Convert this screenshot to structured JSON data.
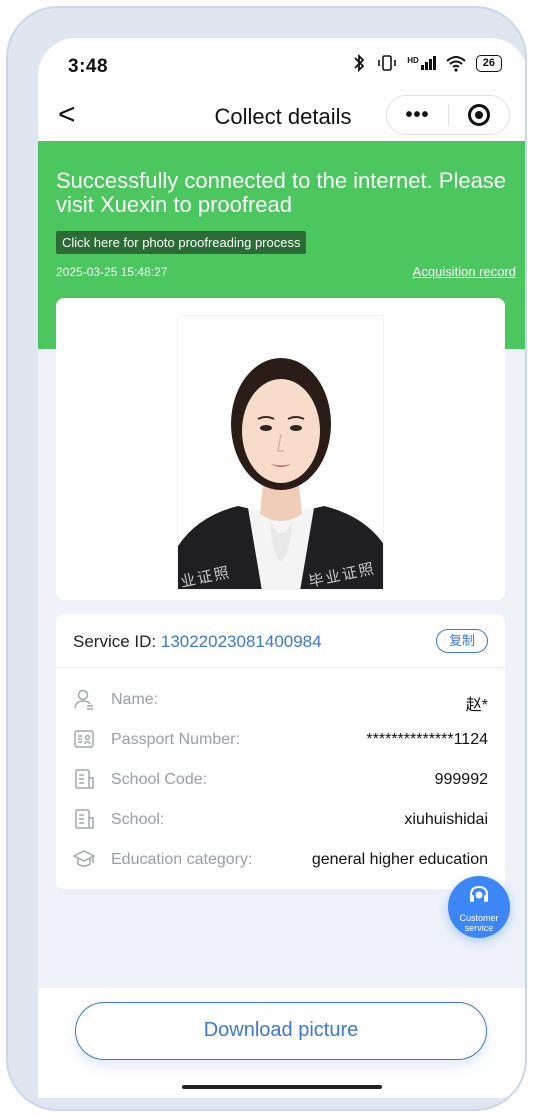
{
  "status_bar": {
    "time": "3:48",
    "icons": [
      "bluetooth-icon",
      "vibrate-icon",
      "hd-signal-icon",
      "wifi-icon"
    ],
    "signal_text": "HD",
    "battery": "26"
  },
  "nav": {
    "title": "Collect details",
    "back": "<",
    "more": "•••"
  },
  "banner": {
    "headline": "Successfully connected to the internet. Please visit Xuexin to proofread",
    "proofread_link": "Click here for photo proofreading process",
    "timestamp": "2025-03-25 15:48:27",
    "record_link": "Acquisition record",
    "color": "#4cc75f"
  },
  "photo": {
    "watermark_left": "业证照",
    "watermark_right": "毕业证照"
  },
  "info": {
    "service_label": "Service ID: ",
    "service_id": "13022023081400984",
    "copy_label": "复制",
    "fields": [
      {
        "icon": "person-icon",
        "label": "Name:",
        "value": "赵*"
      },
      {
        "icon": "id-card-icon",
        "label": "Passport Number:",
        "value": "**************1124"
      },
      {
        "icon": "document-icon",
        "label": "School Code:",
        "value": "999992"
      },
      {
        "icon": "document-icon",
        "label": "School:",
        "value": "xiuhuishidai"
      },
      {
        "icon": "graduation-cap-icon",
        "label": "Education category:",
        "value": "general higher education"
      }
    ]
  },
  "customer_service": {
    "label_line1": "Customer",
    "label_line2": "service",
    "icon": "headset-icon",
    "color": "#3d86f5"
  },
  "footer": {
    "download_label": "Download picture",
    "accent": "#3a78d6"
  }
}
